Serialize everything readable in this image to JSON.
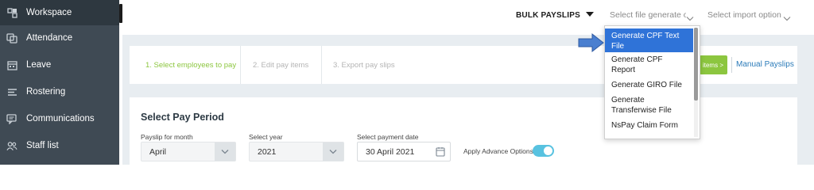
{
  "sidebar": {
    "items": [
      {
        "label": "Workspace",
        "icon": "workspace-icon"
      },
      {
        "label": "Attendance",
        "icon": "attendance-icon"
      },
      {
        "label": "Leave",
        "icon": "calendar-icon"
      },
      {
        "label": "Rostering",
        "icon": "list-icon"
      },
      {
        "label": "Communications",
        "icon": "chat-icon"
      },
      {
        "label": "Staff list",
        "icon": "people-icon"
      }
    ]
  },
  "topbar": {
    "bulk_payslips": "BULK PAYSLIPS",
    "select_file_placeholder": "Select file generate o...",
    "select_import_placeholder": "Select import option"
  },
  "steps": {
    "step1": "1. Select employees to pay",
    "step2": "2. Edit pay items",
    "step3": "3. Export pay slips",
    "next_button": "items >",
    "manual_payslips": "Manual Payslips"
  },
  "pay_period": {
    "title": "Select Pay Period",
    "month_label": "Payslip for month",
    "month_value": "April",
    "year_label": "Select year",
    "year_value": "2021",
    "date_label": "Select payment date",
    "date_value": "30 April 2021",
    "advance_label": "Apply Advance Options",
    "advance_enabled": true
  },
  "file_dropdown": {
    "options": [
      "Generate CPF Text File",
      "Generate CPF Report",
      "Generate GIRO File",
      "Generate Transferwise File",
      "NsPay Claim Form"
    ],
    "selected_index": 0
  },
  "colors": {
    "sidebar_bg": "#3f4a54",
    "accent_green": "#8cc63f",
    "link_blue": "#2b7bb9",
    "selected_blue": "#2f73d8",
    "toggle_blue": "#58c2e0"
  }
}
